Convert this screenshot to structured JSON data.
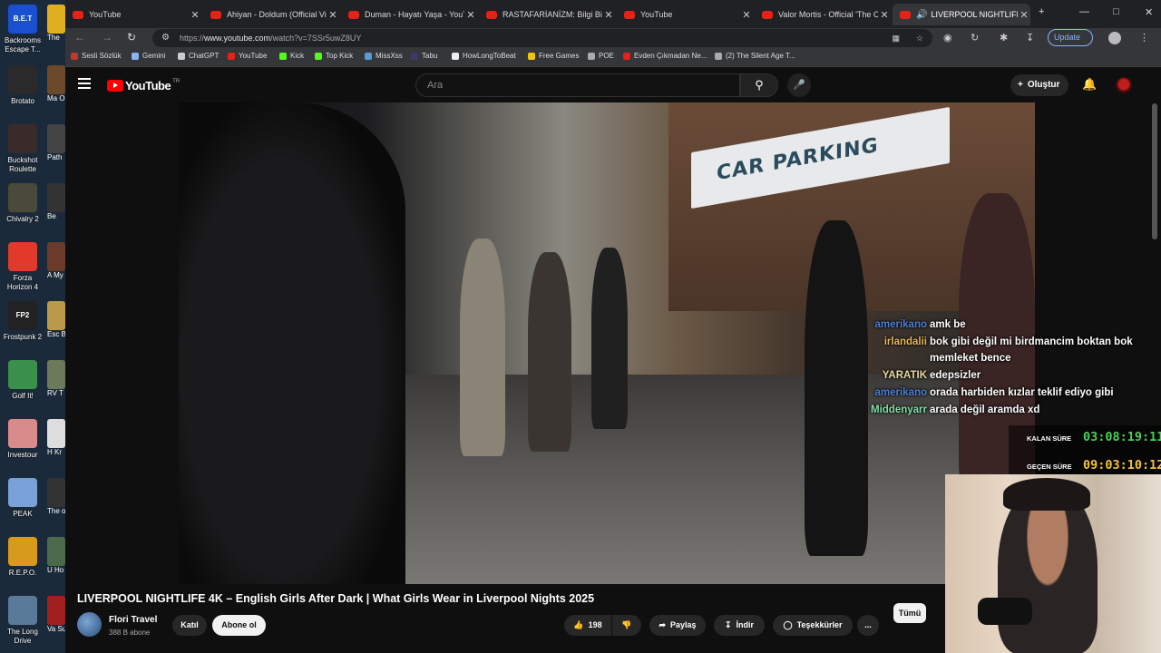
{
  "desktop": {
    "icons": [
      {
        "label": "Backrooms Escape T...",
        "color": "#1a4fd1",
        "text": "B.E.T"
      },
      {
        "label": "Brotato",
        "color": "#2a2a2a",
        "text": ""
      },
      {
        "label": "Buckshot Roulette",
        "color": "#3a2b2b",
        "text": ""
      },
      {
        "label": "Chivalry 2",
        "color": "#4a4a3a",
        "text": ""
      },
      {
        "label": "Forza Horizon 4",
        "color": "#e23a2a",
        "text": ""
      },
      {
        "label": "Frostpunk 2",
        "color": "#222",
        "text": "FP2"
      },
      {
        "label": "Golf It!",
        "color": "#3a8f4a",
        "text": ""
      },
      {
        "label": "Investour",
        "color": "#d98a8a",
        "text": ""
      },
      {
        "label": "PEAK",
        "color": "#7aa0d8",
        "text": ""
      },
      {
        "label": "R.E.P.O.",
        "color": "#d89a1a",
        "text": ""
      },
      {
        "label": "The Long Drive",
        "color": "#5a7a9a",
        "text": ""
      }
    ],
    "col2": [
      {
        "label": "The",
        "color": "#e0b020"
      },
      {
        "label": "Ma Old",
        "color": "#6a4a2a"
      },
      {
        "label": "Path",
        "color": "#444"
      },
      {
        "label": "Be",
        "color": "#333"
      },
      {
        "label": "A My",
        "color": "#6a3a2a"
      },
      {
        "label": "Esc Bac",
        "color": "#b89a4a"
      },
      {
        "label": "RV T",
        "color": "#6a7a5a"
      },
      {
        "label": "H Kr",
        "color": "#ddd"
      },
      {
        "label": "The of Is",
        "color": "#333"
      },
      {
        "label": "U Ho",
        "color": "#4a6a4a"
      },
      {
        "label": "Va Su",
        "color": "#a02020"
      }
    ]
  },
  "browser": {
    "tabs": [
      {
        "title": "YouTube",
        "active": false
      },
      {
        "title": "Ahiyan - Doldum (Official Video",
        "active": false
      },
      {
        "title": "Duman - Hayatı Yaşa - YouTube",
        "active": false
      },
      {
        "title": "RASTAFARİANİZM: Bilgi Bitkisin",
        "active": false
      },
      {
        "title": "YouTube",
        "active": false
      },
      {
        "title": "Valor Mortis - Official 'The Crim",
        "active": false
      },
      {
        "title": "LIVERPOOL NIGHTLIFE 4K",
        "active": true
      }
    ],
    "new_tab": "+",
    "url_prefix": "https://",
    "url_host": "www.youtube.com",
    "url_path": "/watch?v=7SSr5uwZ8UY",
    "update_label": "Update",
    "bookmarks": [
      {
        "label": "Sesli Sözlük",
        "color": "#c0392b"
      },
      {
        "label": "Gemini",
        "color": "#8ab4f8"
      },
      {
        "label": "ChatGPT",
        "color": "#ccc"
      },
      {
        "label": "YouTube",
        "color": "#e62117"
      },
      {
        "label": "Kick",
        "color": "#53fc18"
      },
      {
        "label": "Top Kick",
        "color": "#53fc18"
      },
      {
        "label": "MissXss",
        "color": "#5a9ad8"
      },
      {
        "label": "Tabu",
        "color": "#3a3a6a"
      },
      {
        "label": "HowLongToBeat",
        "color": "#eee"
      },
      {
        "label": "Free Games",
        "color": "#f1c40f"
      },
      {
        "label": "POE",
        "color": "#aaa"
      },
      {
        "label": "Evden Çıkmadan Ne...",
        "color": "#e62117"
      },
      {
        "label": "(2) The Silent Age T...",
        "color": "#aaa"
      }
    ]
  },
  "youtube": {
    "logo": "YouTube",
    "region": "TR",
    "search_placeholder": "Ara",
    "create_label": "Oluştur",
    "video_title": "LIVERPOOL NIGHTLIFE 4K – English Girls After Dark | What Girls Wear in Liverpool Nights 2025",
    "channel": "Flori Travel",
    "subscribers": "388 B abone",
    "join_label": "Katıl",
    "subscribe_label": "Abone ol",
    "likes": "198",
    "share_label": "Paylaş",
    "download_label": "İndir",
    "thanks_label": "Teşekkürler",
    "more_label": "...",
    "filter_all": "Tümü",
    "sign_text": "CAR PARKING"
  },
  "overlay": {
    "chat": [
      {
        "user": "amerikano",
        "color": "#4a7fd8",
        "message": "amk be"
      },
      {
        "user": "irlandalii",
        "color": "#e8b85a",
        "message": "bok gibi değil mi birdmancim boktan bok"
      },
      {
        "user": "",
        "color": "#fff",
        "message": "memleket bence"
      },
      {
        "user": "YARATIK",
        "color": "#e8d8a0",
        "message": "edepsizler"
      },
      {
        "user": "amerikano",
        "color": "#4a7fd8",
        "message": "orada harbiden kızlar teklif ediyo gibi"
      },
      {
        "user": "Middenyarr",
        "color": "#7fe0a8",
        "message": "arada değil aramda xd"
      }
    ],
    "remaining_label": "KALAN SÜRE",
    "remaining_value": "03:08:19:11",
    "remaining_color": "#4ad05a",
    "elapsed_label": "GEÇEN SÜRE",
    "elapsed_value": "09:03:10:12",
    "elapsed_color": "#f2c23a"
  }
}
